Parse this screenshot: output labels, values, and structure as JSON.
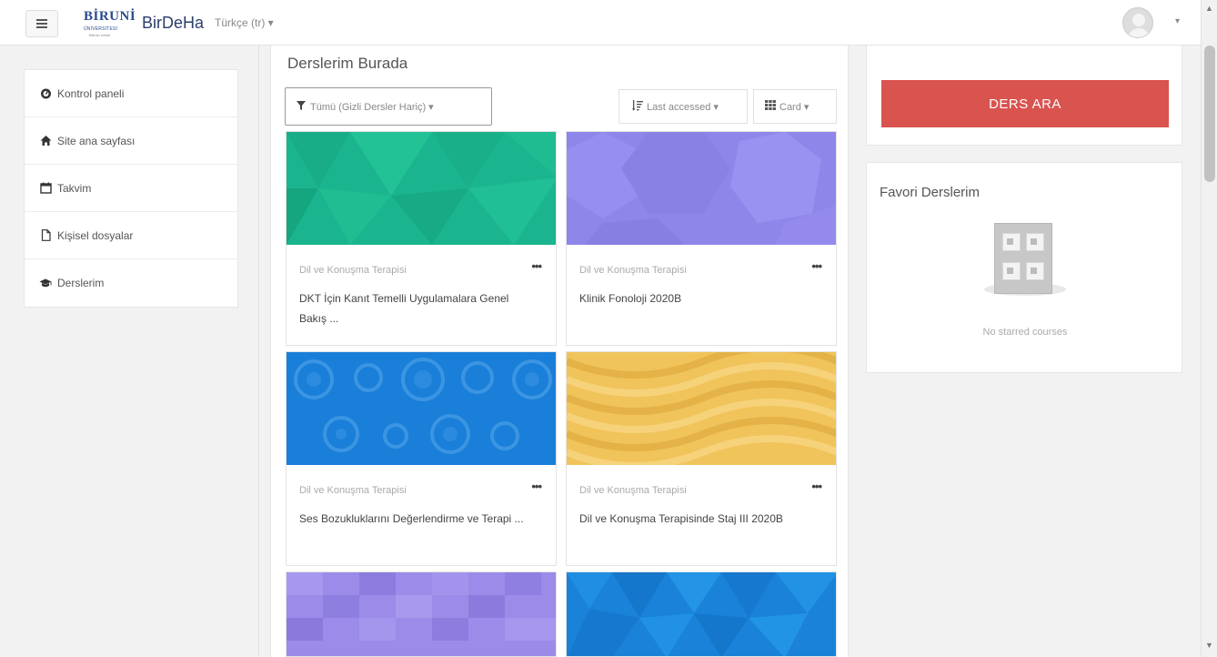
{
  "header": {
    "logo_text": "BİRUNİ",
    "logo_sub": "ÜNİVERSİTESİ",
    "logo_tagline": "Bilimin izinde",
    "site_name": "BirDeHa",
    "language": "Türkçe (tr) ▾",
    "user_caret": "▾"
  },
  "sidebar": {
    "items": [
      {
        "label": "Kontrol paneli",
        "icon": "dashboard-icon"
      },
      {
        "label": "Site ana sayfası",
        "icon": "home-icon"
      },
      {
        "label": "Takvim",
        "icon": "calendar-icon"
      },
      {
        "label": "Kişisel dosyalar",
        "icon": "file-icon"
      },
      {
        "label": "Derslerim",
        "icon": "graduation-cap-icon"
      }
    ]
  },
  "main": {
    "title": "Derslerim Burada",
    "filter_label": "Tümü (Gizli Dersler Hariç) ▾",
    "sort_label": "Last accessed ▾",
    "view_label": "Card ▾",
    "more_glyph": "•••",
    "courses": [
      {
        "category": "Dil ve Konuşma Terapisi",
        "name": "DKT İçin Kanıt Temelli Uygulamalara Genel Bakış ...",
        "pattern": "triangles-green",
        "color": "#1ab58e"
      },
      {
        "category": "Dil ve Konuşma Terapisi",
        "name": "Klinik Fonoloji 2020B",
        "pattern": "hexagons-purple",
        "color": "#8f86ea"
      },
      {
        "category": "Dil ve Konuşma Terapisi",
        "name": "Ses Bozukluklarını Değerlendirme ve Terapi ...",
        "pattern": "circles-blue",
        "color": "#1a7fd8"
      },
      {
        "category": "Dil ve Konuşma Terapisi",
        "name": "Dil ve Konuşma Terapisinde Staj III 2020B",
        "pattern": "waves-yellow",
        "color": "#f0c45a"
      },
      {
        "category": "",
        "name": "",
        "pattern": "squares-purple",
        "color": "#9c8be8"
      },
      {
        "category": "",
        "name": "",
        "pattern": "triangles-blue",
        "color": "#1a82d9"
      }
    ]
  },
  "right": {
    "search_button": "DERS ARA",
    "favorites_title": "Favori Derslerim",
    "favorites_empty": "No starred courses"
  },
  "colors": {
    "danger": "#d9534f",
    "brand_blue": "#2a4a8c"
  }
}
